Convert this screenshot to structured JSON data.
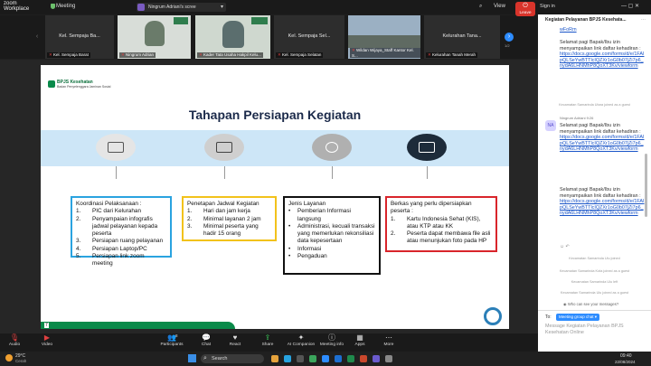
{
  "window": {
    "brand_line1": "zoom",
    "brand_line2": "Workplace",
    "meeting_label": "Meeting",
    "screen_share_label": "Ningrum Adriani's scree",
    "sign_in": "Sign in",
    "view": "View"
  },
  "gallery": {
    "tiles": [
      {
        "name": "Kel. Sempaja Ba...",
        "foot": "Kel. Sempaja Barat"
      },
      {
        "name": "",
        "foot": "Ningrum Adrian"
      },
      {
        "name": "",
        "foot": "Kader Tata Usaha Hakpil Kelu..."
      },
      {
        "name": "Kel. Sempaja Sel...",
        "foot": "Kel. Sempaja Selatan"
      },
      {
        "name": "",
        "foot": "Wildan Wijaya_Staff Kantor Kel. S..."
      },
      {
        "name": "Kelurahan Tana...",
        "foot": "Kelurahan Tanah Merah"
      }
    ],
    "page_indicator": "1/2"
  },
  "slide": {
    "logo_text": "BPJS Kesehatan",
    "logo_sub": "Badan Penyelenggara Jaminan Sosial",
    "title": "Tahapan Persiapan Kegiatan",
    "page_number": "7",
    "circle_colors": [
      "#e5e5e5",
      "#cfcfcf",
      "#b0b0b0",
      "#1d2b3a"
    ],
    "box1": {
      "heading": "Koordinasi Pelaksanaan :",
      "items": [
        {
          "n": "1.",
          "t": "PIC dari Kelurahan"
        },
        {
          "n": "2.",
          "t": "Penyampaian infografis jadwal pelayanan kepada peserta"
        },
        {
          "n": "3.",
          "t": "Persiapan ruang pelayanan"
        },
        {
          "n": "4.",
          "t": "Persiapan Laptop/PC"
        },
        {
          "n": "5.",
          "t": "Persiapan link zoom meeting"
        }
      ],
      "border_color": "#2aa3e0"
    },
    "box2": {
      "heading": "Penetapan Jadwal Kegiatan",
      "items": [
        {
          "n": "1.",
          "t": "Hari dan jam kerja"
        },
        {
          "n": "2.",
          "t": "Minimal layanan 2 jam"
        },
        {
          "n": "3.",
          "t": "Minimal peserta yang hadir 15 orang"
        }
      ],
      "border_color": "#f2c21b"
    },
    "box3": {
      "heading": "Jenis Layanan",
      "items": [
        {
          "t": "Pemberian Informasi langsung"
        },
        {
          "t": "Administrasi, kecuali transaksi yang memerlukan rekonsiliasi data kepesertaan"
        },
        {
          "t": "Informasi"
        },
        {
          "t": "Pengaduan"
        }
      ],
      "border_color": "#111111"
    },
    "box4": {
      "heading": "Berkas yang perlu dipersiapkan peserta :",
      "items": [
        {
          "n": "1.",
          "t": "Kartu Indonesia Sehat (KIS), atau KTP atau KK"
        },
        {
          "n": "2.",
          "t": "Peserta dapat membawa file asli atau menunjukan foto pada HP"
        }
      ],
      "border_color": "#d9252b"
    }
  },
  "toolbar": {
    "items": [
      {
        "label": "Audio",
        "icon": "mic-icon"
      },
      {
        "label": "Video",
        "icon": "video-icon"
      },
      {
        "label": "Participants",
        "icon": "people-icon",
        "badge": "8"
      },
      {
        "label": "Chat",
        "icon": "chat-icon"
      },
      {
        "label": "React",
        "icon": "heart-icon"
      },
      {
        "label": "Share",
        "icon": "share-icon"
      },
      {
        "label": "AI Companion",
        "icon": "sparkle-icon"
      },
      {
        "label": "Meeting info",
        "icon": "info-icon"
      },
      {
        "label": "Apps",
        "icon": "apps-icon"
      },
      {
        "label": "More",
        "icon": "more-icon"
      }
    ],
    "leave": "Leave",
    "leave_color": "#d9342b"
  },
  "taskbar": {
    "weather_temp": "29°C",
    "weather_desc": "Cerah",
    "search_label": "Search",
    "time": "09:40",
    "date": "22/08/2024"
  },
  "chat": {
    "title": "Kegiatan Pelayanan BPJS Kesehata...",
    "link_top": "wFoRm",
    "msg1": "Selamat pagi Bapak/Ibu izin menyampaikan link daftar kehadiran :",
    "link1": "https://docs.google.com/forms/d/e/1FAIpQLSeYwBTTlcIQZXr1oG0b07jZi7p6_nydA6LHNMhP8QoXT3Kv/viewform",
    "sys1": "Kecamatan Samarinda Utara joined as a guest",
    "sender": "Ningrum Adriani",
    "sender_time": "9:26",
    "avatar": "NA",
    "msg2": "Selamat pagi Bapak/Ibu izin menyampaikan link daftar kehadiran :",
    "link2": "https://docs.google.com/forms/d/e/1FAIpQLSeYwBTTlcIQZXr1oG0b07jZi7p6_nydA6LHNMhP8QoXT3Kv/viewform",
    "msg3": "Selamat pagi Bapak/Ibu izin menyampaikan link daftar kehadiran :",
    "link3": "https://docs.google.com/forms/d/e/1FAIpQLSeYwBTTlcIQZXr1oG0b07jZi7p6_nydA6LHNMhP8QoXT3Kv/viewform",
    "sys2": "Kecamatan Samarinda Ulu joined",
    "sys3": "Kecamatan Samarinda Kota joined as a guest",
    "sys4": "Kecamatan Samarinda Ulu left",
    "sys5": "Kecamatan Samarinda Ulu joined as a guest",
    "who_can_see": "Who can see your messages?",
    "to_label": "To:",
    "to_value": "Meeting group chat",
    "input_placeholder": "Message Kegiatan Pelayanan BPJS Kesehatan Online"
  }
}
